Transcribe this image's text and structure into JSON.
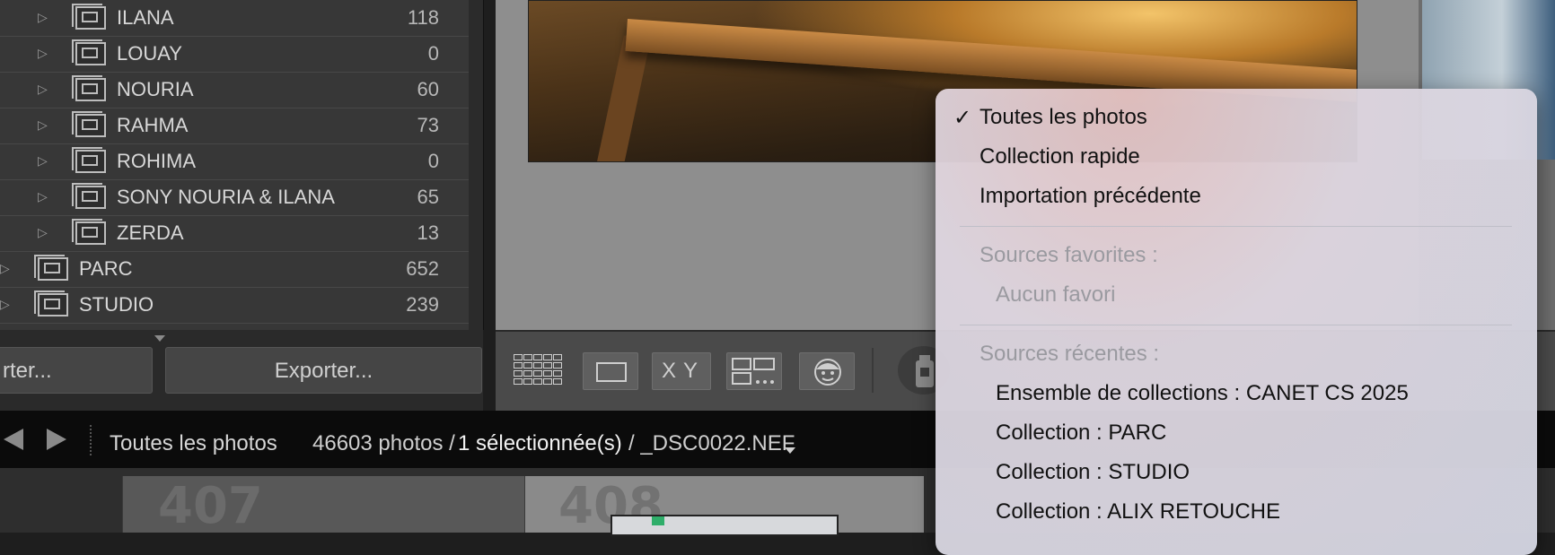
{
  "collections": {
    "items": [
      {
        "name": "ILANA",
        "count": "118"
      },
      {
        "name": "LOUAY",
        "count": "0"
      },
      {
        "name": "NOURIA",
        "count": "60"
      },
      {
        "name": "RAHMA",
        "count": "73"
      },
      {
        "name": "ROHIMA",
        "count": "0"
      },
      {
        "name": "SONY NOURIA & ILANA",
        "count": "65"
      },
      {
        "name": "ZERDA",
        "count": "13"
      },
      {
        "name": "PARC",
        "count": "652"
      },
      {
        "name": "STUDIO",
        "count": "239"
      }
    ]
  },
  "left_buttons": {
    "import_label": "rter...",
    "export_label": "Exporter..."
  },
  "toolbar": {
    "compare_x": "X",
    "compare_y": "Y"
  },
  "filmstrip": {
    "source": "Toutes les photos",
    "photo_count": "46603 photos /",
    "selected": "1 sélectionnée(s)",
    "filename": "/ _DSC0022.NEF",
    "cells": [
      "407",
      "408"
    ]
  },
  "source_menu": {
    "all_photos": "Toutes les photos",
    "quick_collection": "Collection rapide",
    "previous_import": "Importation précédente",
    "favorites_header": "Sources favorites :",
    "no_favorites": "Aucun favori",
    "recent_header": "Sources récentes :",
    "recent": [
      "Ensemble de collections : CANET CS 2025",
      "Collection : PARC",
      "Collection : STUDIO",
      "Collection : ALIX RETOUCHE"
    ],
    "check_mark": "✓"
  }
}
